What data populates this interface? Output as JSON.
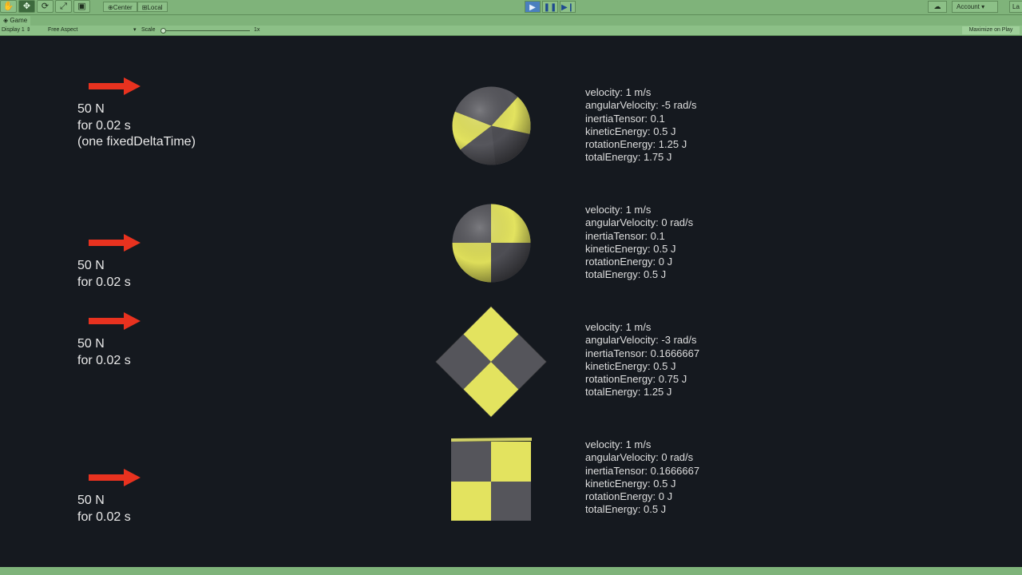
{
  "toolbar": {
    "tools": [
      "hand-tool",
      "move-tool",
      "rotate-tool",
      "scale-tool",
      "rect-tool"
    ],
    "pivot_center": "Center",
    "pivot_local": "Local",
    "account_label": "Account",
    "layers_label": "La"
  },
  "game_view": {
    "tab_label": "Game",
    "display_label": "Display 1",
    "aspect_label": "Free Aspect",
    "scale_label": "Scale",
    "scale_value": "1x",
    "maximize_label": "Maximize on Play"
  },
  "rows": [
    {
      "force_text": "50 N\nfor 0.02 s\n(one fixedDeltaTime)",
      "shape": "sphere-rotating",
      "stats": [
        "velocity: 1 m/s",
        "angularVelocity: -5 rad/s",
        "inertiaTensor: 0.1",
        "kineticEnergy: 0.5 J",
        "rotationEnergy: 1.25 J",
        "totalEnergy: 1.75 J"
      ]
    },
    {
      "force_text": "50 N\nfor 0.02 s",
      "shape": "sphere",
      "stats": [
        "velocity: 1 m/s",
        "angularVelocity: 0 rad/s",
        "inertiaTensor: 0.1",
        "kineticEnergy: 0.5 J",
        "rotationEnergy: 0 J",
        "totalEnergy: 0.5 J"
      ]
    },
    {
      "force_text": "50 N\nfor 0.02 s",
      "shape": "cube-rotating",
      "stats": [
        "velocity: 1 m/s",
        "angularVelocity: -3 rad/s",
        "inertiaTensor: 0.1666667",
        "kineticEnergy: 0.5 J",
        "rotationEnergy: 0.75 J",
        "totalEnergy: 1.25 J"
      ]
    },
    {
      "force_text": "50 N\nfor 0.02 s",
      "shape": "cube",
      "stats": [
        "velocity: 1 m/s",
        "angularVelocity: 0 rad/s",
        "inertiaTensor: 0.1666667",
        "kineticEnergy: 0.5 J",
        "rotationEnergy: 0 J",
        "totalEnergy: 0.5 J"
      ]
    }
  ],
  "colors": {
    "background": "#15191f",
    "arrow": "#e8321f",
    "checker_yellow": "#e3e35f",
    "checker_gray": "#54545a",
    "chrome_green": "#7fb37a"
  }
}
